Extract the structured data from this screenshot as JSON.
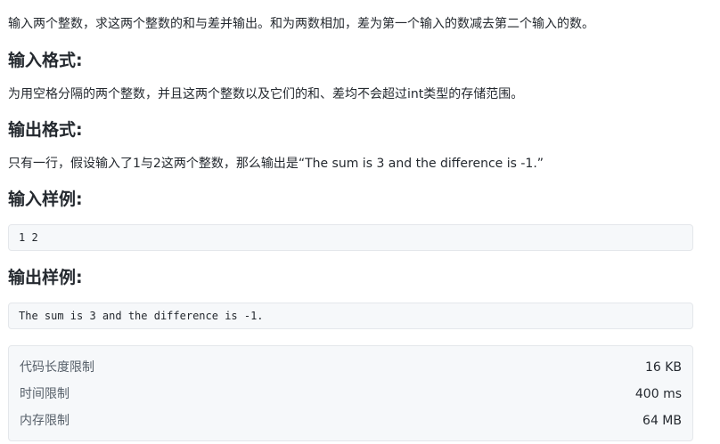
{
  "problem": {
    "intro": "输入两个整数，求这两个整数的和与差并输出。和为两数相加，差为第一个输入的数减去第二个输入的数。",
    "input_format_title": "输入格式:",
    "input_format_text": "为用空格分隔的两个整数，并且这两个整数以及它们的和、差均不会超过int类型的存储范围。",
    "output_format_title": "输出格式:",
    "output_format_text": "只有一行，假设输入了1与2这两个整数，那么输出是“The sum is 3 and the difference is -1.”",
    "input_sample_title": "输入样例:",
    "input_sample_code": "1 2",
    "output_sample_title": "输出样例:",
    "output_sample_code": "The sum is 3 and the difference is -1."
  },
  "limits": [
    {
      "label": "代码长度限制",
      "value": "16 KB"
    },
    {
      "label": "时间限制",
      "value": "400 ms"
    },
    {
      "label": "内存限制",
      "value": "64 MB"
    }
  ]
}
